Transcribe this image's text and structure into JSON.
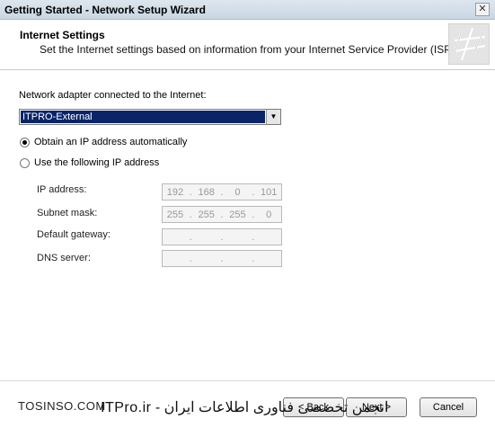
{
  "window": {
    "title": "Getting Started - Network Setup Wizard",
    "close_glyph": "✕"
  },
  "header": {
    "title": "Internet Settings",
    "subtitle": "Set the Internet settings based on information from your Internet Service Provider (ISP)."
  },
  "adapter": {
    "label": "Network adapter connected to the Internet:",
    "selected": "ITPRO-External",
    "arrow_glyph": "▼"
  },
  "ip_mode": {
    "options": [
      {
        "label": "Obtain an IP address automatically",
        "selected": true
      },
      {
        "label": "Use the following IP address",
        "selected": false
      }
    ]
  },
  "fields": [
    {
      "label": "IP address:",
      "octets": [
        "192",
        "168",
        "0",
        "101"
      ]
    },
    {
      "label": "Subnet mask:",
      "octets": [
        "255",
        "255",
        "255",
        "0"
      ]
    },
    {
      "label": "Default gateway:",
      "octets": [
        "",
        "",
        "",
        ""
      ]
    },
    {
      "label": "DNS server:",
      "octets": [
        "",
        "",
        "",
        ""
      ]
    }
  ],
  "footer": {
    "back_label": "< Back",
    "next_label": "Next >",
    "cancel_label": "Cancel",
    "watermark_left": "TOSINSO.COM",
    "watermark_right": "انجمن تخصصی فناوری اطلاعات ایران - ITPro.ir"
  }
}
